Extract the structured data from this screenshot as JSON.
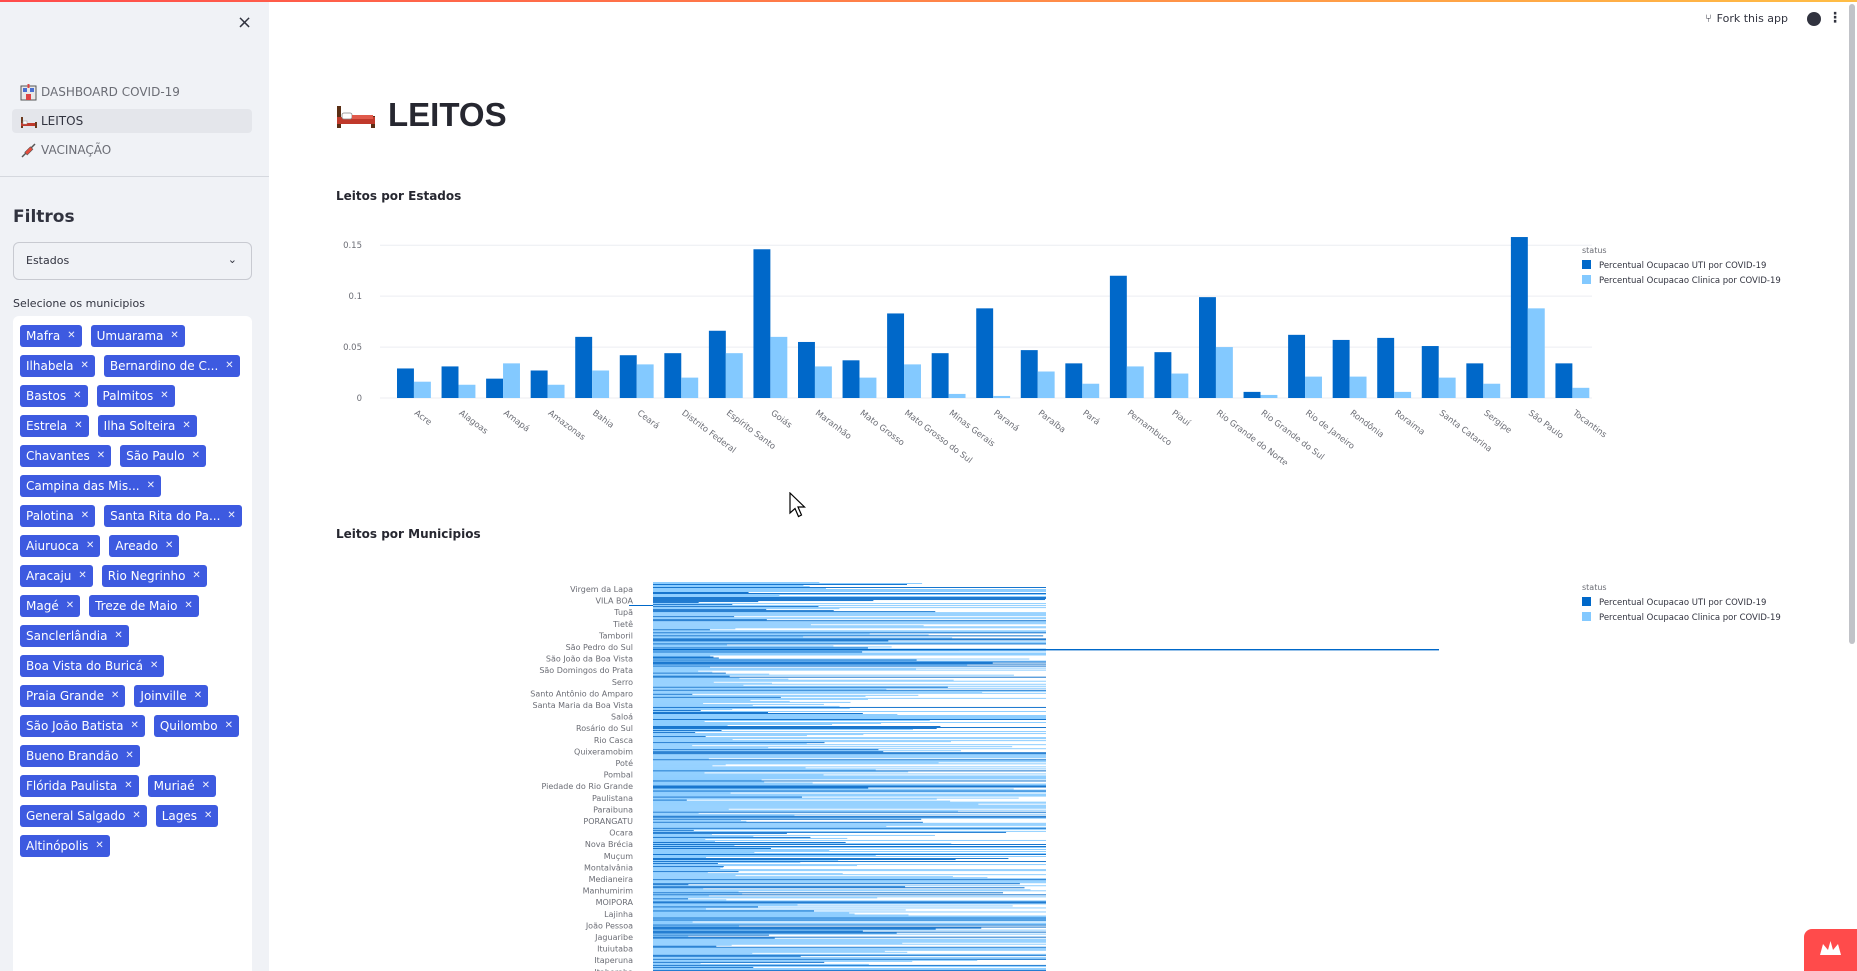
{
  "sidebar": {
    "close_icon": "×",
    "nav": [
      {
        "label": "DASHBOARD COVID-19",
        "icon": "hospital-icon",
        "active": false
      },
      {
        "label": "LEITOS",
        "icon": "bed-icon",
        "active": true
      },
      {
        "label": "VACINAÇÃO",
        "icon": "syringe-icon",
        "active": false
      }
    ],
    "filters_title": "Filtros",
    "select_value": "Estados",
    "municipios_label": "Selecione os municipios",
    "tags": [
      "Mafra",
      "Umuarama",
      "Ilhabela",
      "Bernardino de C...",
      "Bastos",
      "Palmitos",
      "Estrela",
      "Ilha Solteira",
      "Chavantes",
      "São Paulo",
      "Campina das Mis...",
      "Palotina",
      "Santa Rita do Pa...",
      "Aiuruoca",
      "Areado",
      "Aracaju",
      "Rio Negrinho",
      "Magé",
      "Treze de Maio",
      "Sanclerlândia",
      "Boa Vista do Buricá",
      "Praia Grande",
      "Joinville",
      "São João Batista",
      "Quilombo",
      "Bueno Brandão",
      "Flórida Paulista",
      "Muriaé",
      "General Salgado",
      "Lages",
      "Altinópolis"
    ]
  },
  "header": {
    "fork_label": "Fork this app"
  },
  "page": {
    "title": "LEITOS"
  },
  "chart_data": [
    {
      "type": "bar",
      "title": "Leitos por Estados",
      "legend_title": "status",
      "legend_position": "top-right",
      "ylim": [
        0,
        0.16
      ],
      "yticks": [
        0,
        0.05,
        0.1,
        0.15
      ],
      "ytick_labels": [
        "0",
        "0.05",
        "0.1",
        "0.15"
      ],
      "categories": [
        "Acre",
        "Alagoas",
        "Amapá",
        "Amazonas",
        "Bahia",
        "Ceará",
        "Distrito Federal",
        "Espírito Santo",
        "Goiás",
        "Maranhão",
        "Mato Grosso",
        "Mato Grosso do Sul",
        "Minas Gerais",
        "Paraná",
        "Paraíba",
        "Pará",
        "Pernambuco",
        "Piauí",
        "Rio Grande do Norte",
        "Rio Grande do Sul",
        "Rio de Janeiro",
        "Rondônia",
        "Roraima",
        "Santa Catarina",
        "Sergipe",
        "São Paulo",
        "Tocantins"
      ],
      "series": [
        {
          "name": "Percentual Ocupacao UTI por COVID-19",
          "color": "#0068c9",
          "values": [
            0.029,
            0.031,
            0.019,
            0.027,
            0.06,
            0.042,
            0.044,
            0.066,
            0.146,
            0.055,
            0.037,
            0.083,
            0.044,
            0.088,
            0.047,
            0.034,
            0.12,
            0.045,
            0.099,
            0.006,
            0.062,
            0.057,
            0.059,
            0.051,
            0.034,
            0.158,
            0.034
          ]
        },
        {
          "name": "Percentual Ocupacao Clinica por COVID-19",
          "color": "#83c9ff",
          "values": [
            0.016,
            0.013,
            0.034,
            0.013,
            0.027,
            0.033,
            0.02,
            0.044,
            0.06,
            0.031,
            0.02,
            0.033,
            0.004,
            0.002,
            0.026,
            0.014,
            0.031,
            0.024,
            0.05,
            0.003,
            0.021,
            0.021,
            0.006,
            0.02,
            0.014,
            0.088,
            0.01
          ]
        }
      ]
    },
    {
      "type": "bar",
      "orientation": "horizontal",
      "title": "Leitos por Municipios",
      "legend_title": "status",
      "legend_position": "top-right",
      "categories": [
        "Virgem da Lapa",
        "VILA BOA",
        "Tupã",
        "Tietê",
        "Tamboril",
        "São Pedro do Sul",
        "São João da Boa Vista",
        "São Domingos do Prata",
        "Serro",
        "Santo Antônio do Amparo",
        "Santa Maria da Boa Vista",
        "Saloá",
        "Rosário do Sul",
        "Rio Casca",
        "Quixeramobim",
        "Poté",
        "Pombal",
        "Piedade do Rio Grande",
        "Paulistana",
        "Paraibuna",
        "PORANGATU",
        "Ocara",
        "Nova Brécia",
        "Muçum",
        "Montalvânia",
        "Medianeira",
        "Manhumirim",
        "MOIPORA",
        "Lajinha",
        "João Pessoa",
        "Jaguaribe",
        "Ituiutaba",
        "Itaperuna",
        "Itaberaba"
      ],
      "series": [
        {
          "name": "Percentual Ocupacao UTI por COVID-19",
          "color": "#0068c9"
        },
        {
          "name": "Percentual Ocupacao Clinica por COVID-19",
          "color": "#83c9ff"
        }
      ]
    }
  ]
}
